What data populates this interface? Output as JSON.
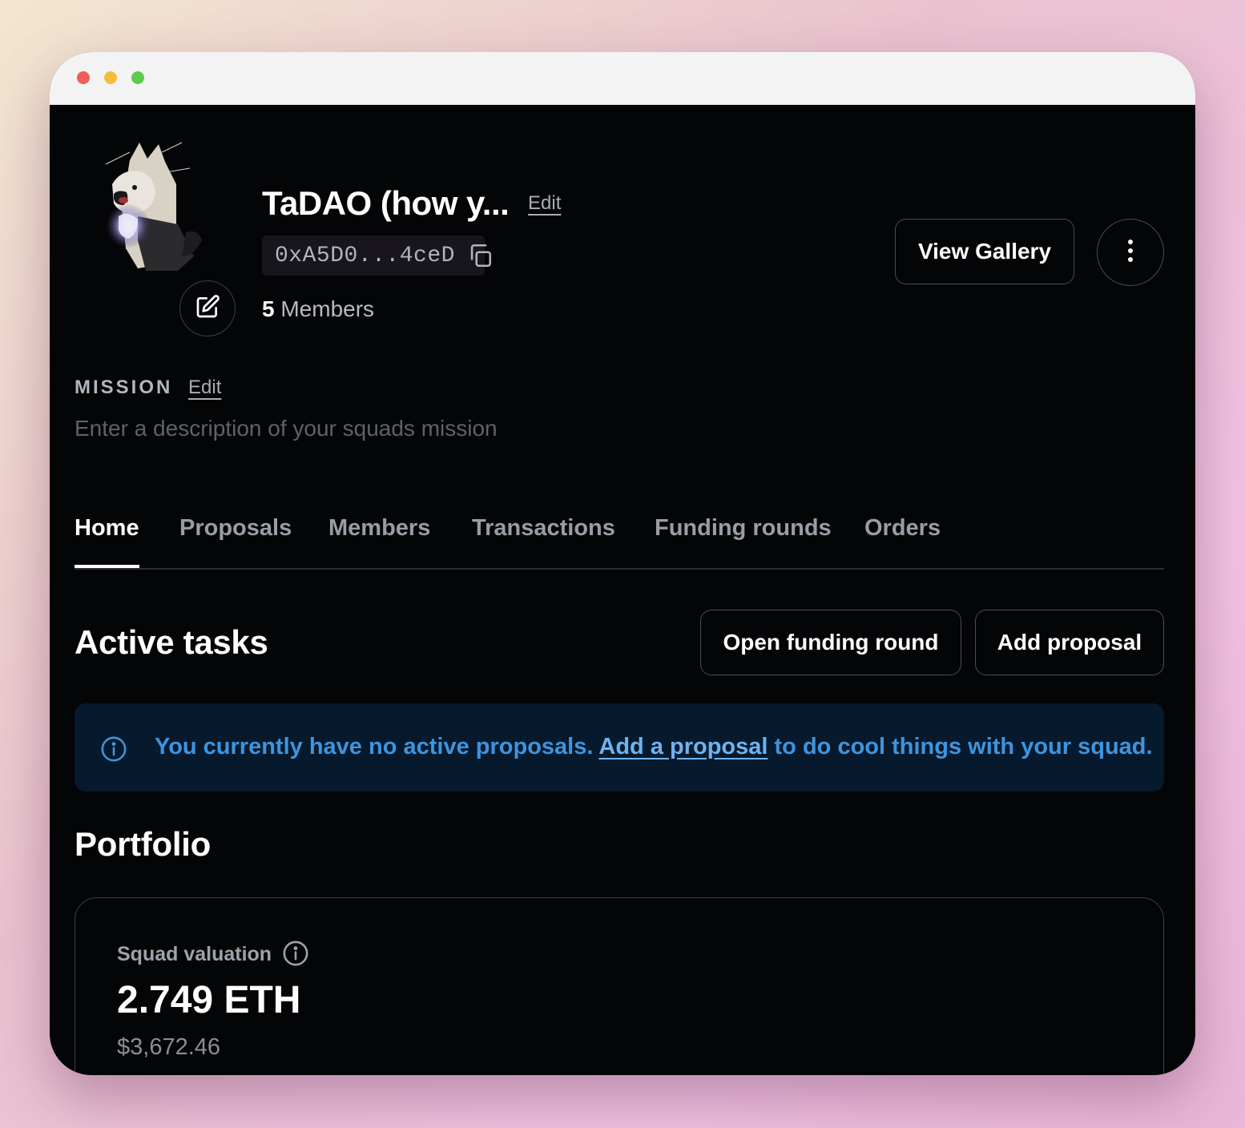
{
  "squad": {
    "name": "TaDAO (how y...",
    "edit_label": "Edit",
    "address": "0xA5D0...4ceD",
    "member_count": "5",
    "members_label": "Members"
  },
  "header_actions": {
    "view_gallery_label": "View Gallery"
  },
  "mission": {
    "label": "MISSION",
    "edit_label": "Edit",
    "placeholder": "Enter a description of your squads mission"
  },
  "tabs": [
    {
      "label": "Home",
      "active": true
    },
    {
      "label": "Proposals",
      "active": false
    },
    {
      "label": "Members",
      "active": false
    },
    {
      "label": "Transactions",
      "active": false
    },
    {
      "label": "Funding rounds",
      "active": false
    },
    {
      "label": "Orders",
      "active": false
    }
  ],
  "active_tasks": {
    "title": "Active tasks",
    "open_funding_label": "Open funding round",
    "add_proposal_label": "Add proposal"
  },
  "info_banner": {
    "text_before": "You currently have no active proposals. ",
    "link_text": "Add a proposal",
    "text_after": " to do cool things with your squad."
  },
  "portfolio": {
    "title": "Portfolio",
    "valuation_label": "Squad valuation",
    "valuation_eth": "2.749 ETH",
    "valuation_usd": "$3,672.46"
  },
  "colors": {
    "background": "#040507",
    "info_text": "#3e94df",
    "info_bg": "#071a2d",
    "muted_text": "#9a9ca6"
  },
  "icons": {
    "avatar_edit": "pencil-square-icon",
    "copy": "copy-icon",
    "more": "vertical-dots-icon",
    "info": "info-circle-icon"
  }
}
